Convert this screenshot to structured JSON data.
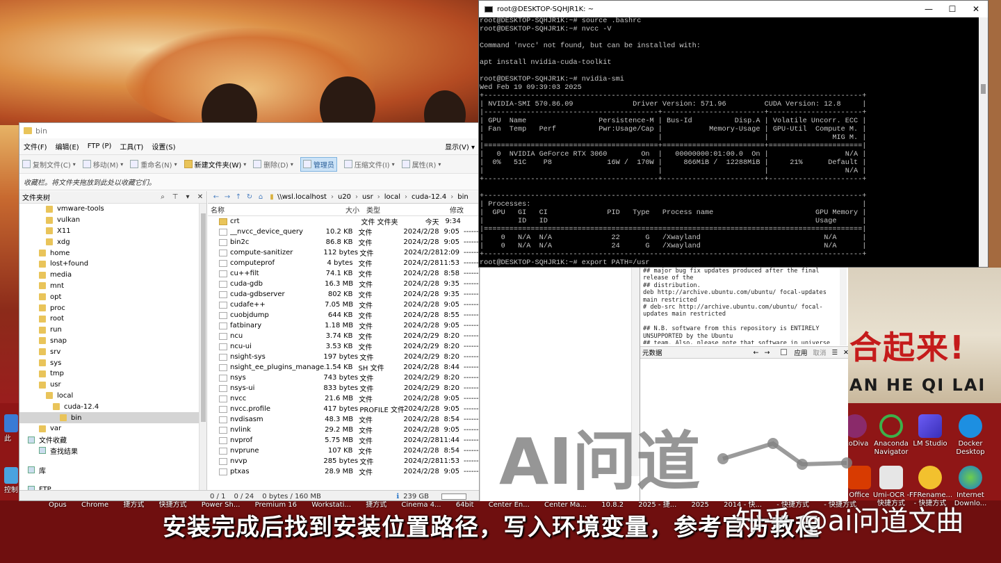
{
  "explorer": {
    "title": "bin",
    "menu": [
      "文件(F)",
      "编辑(E)",
      "FTP (P)",
      "工具(T)",
      "设置(S)"
    ],
    "menu_right": "显示(V) ▾",
    "toolbar": [
      "复制文件(C)",
      "移动(M)",
      "重命名(N)",
      "新建文件夹(W)",
      "删除(D)",
      "管理员",
      "压缩文件(I)",
      "属性(R)"
    ],
    "favorites_hint": "收藏栏。将文件夹拖放到此处以收藏它们。",
    "tree_header": "文件夹树",
    "tree": [
      {
        "label": "vmware-tools",
        "indent": 2
      },
      {
        "label": "vulkan",
        "indent": 2
      },
      {
        "label": "X11",
        "indent": 2
      },
      {
        "label": "xdg",
        "indent": 2
      },
      {
        "label": "home",
        "indent": 1
      },
      {
        "label": "lost+found",
        "indent": 1
      },
      {
        "label": "media",
        "indent": 1
      },
      {
        "label": "mnt",
        "indent": 1
      },
      {
        "label": "opt",
        "indent": 1
      },
      {
        "label": "proc",
        "indent": 1
      },
      {
        "label": "root",
        "indent": 1
      },
      {
        "label": "run",
        "indent": 1
      },
      {
        "label": "snap",
        "indent": 1
      },
      {
        "label": "srv",
        "indent": 1
      },
      {
        "label": "sys",
        "indent": 1
      },
      {
        "label": "tmp",
        "indent": 1
      },
      {
        "label": "usr",
        "indent": 1
      },
      {
        "label": "local",
        "indent": 2
      },
      {
        "label": "cuda-12.4",
        "indent": 3
      },
      {
        "label": "bin",
        "indent": 4,
        "selected": true
      },
      {
        "label": "var",
        "indent": 1
      }
    ],
    "tree_extras": [
      "文件收藏",
      "查找结果",
      "库",
      "FTP"
    ],
    "address": [
      "\\\\wsl.localhost",
      "u20",
      "usr",
      "local",
      "cuda-12.4",
      "bin"
    ],
    "columns": {
      "name": "名称",
      "size": "大小",
      "type": "类型",
      "modified": "修改"
    },
    "files": [
      {
        "name": "crt",
        "size": "",
        "type": "文件 文件夹",
        "date": "今天",
        "time": "9:34",
        "perm": "",
        "folder": true
      },
      {
        "name": "__nvcc_device_query",
        "size": "10.2 KB",
        "type": "文件",
        "date": "2024/2/28",
        "time": "9:05",
        "perm": "-------"
      },
      {
        "name": "bin2c",
        "size": "86.8 KB",
        "type": "文件",
        "date": "2024/2/28",
        "time": "9:05",
        "perm": "-------"
      },
      {
        "name": "compute-sanitizer",
        "size": "112 bytes",
        "type": "文件",
        "date": "2024/2/28",
        "time": "12:09",
        "perm": "-------"
      },
      {
        "name": "computeprof",
        "size": "4 bytes",
        "type": "文件",
        "date": "2024/2/28",
        "time": "11:53",
        "perm": "-------"
      },
      {
        "name": "cu++filt",
        "size": "74.1 KB",
        "type": "文件",
        "date": "2024/2/28",
        "time": "8:58",
        "perm": "-------"
      },
      {
        "name": "cuda-gdb",
        "size": "16.3 MB",
        "type": "文件",
        "date": "2024/2/28",
        "time": "9:35",
        "perm": "-------"
      },
      {
        "name": "cuda-gdbserver",
        "size": "802 KB",
        "type": "文件",
        "date": "2024/2/28",
        "time": "9:35",
        "perm": "-------"
      },
      {
        "name": "cudafe++",
        "size": "7.05 MB",
        "type": "文件",
        "date": "2024/2/28",
        "time": "9:05",
        "perm": "-------"
      },
      {
        "name": "cuobjdump",
        "size": "644 KB",
        "type": "文件",
        "date": "2024/2/28",
        "time": "8:55",
        "perm": "-------"
      },
      {
        "name": "fatbinary",
        "size": "1.18 MB",
        "type": "文件",
        "date": "2024/2/28",
        "time": "9:05",
        "perm": "-------"
      },
      {
        "name": "ncu",
        "size": "3.74 KB",
        "type": "文件",
        "date": "2024/2/29",
        "time": "8:20",
        "perm": "-------"
      },
      {
        "name": "ncu-ui",
        "size": "3.53 KB",
        "type": "文件",
        "date": "2024/2/29",
        "time": "8:20",
        "perm": "-------"
      },
      {
        "name": "nsight-sys",
        "size": "197 bytes",
        "type": "文件",
        "date": "2024/2/29",
        "time": "8:20",
        "perm": "-------"
      },
      {
        "name": "nsight_ee_plugins_manage.sh",
        "size": "1.54 KB",
        "type": "SH 文件",
        "date": "2024/2/28",
        "time": "8:44",
        "perm": "-------"
      },
      {
        "name": "nsys",
        "size": "743 bytes",
        "type": "文件",
        "date": "2024/2/29",
        "time": "8:20",
        "perm": "-------"
      },
      {
        "name": "nsys-ui",
        "size": "833 bytes",
        "type": "文件",
        "date": "2024/2/29",
        "time": "8:20",
        "perm": "-------"
      },
      {
        "name": "nvcc",
        "size": "21.6 MB",
        "type": "文件",
        "date": "2024/2/28",
        "time": "9:05",
        "perm": "-------"
      },
      {
        "name": "nvcc.profile",
        "size": "417 bytes",
        "type": "PROFILE 文件",
        "date": "2024/2/28",
        "time": "9:05",
        "perm": "-------"
      },
      {
        "name": "nvdisasm",
        "size": "48.3 MB",
        "type": "文件",
        "date": "2024/2/28",
        "time": "8:54",
        "perm": "-------"
      },
      {
        "name": "nvlink",
        "size": "29.2 MB",
        "type": "文件",
        "date": "2024/2/28",
        "time": "9:05",
        "perm": "-------"
      },
      {
        "name": "nvprof",
        "size": "5.75 MB",
        "type": "文件",
        "date": "2024/2/28",
        "time": "11:44",
        "perm": "-------"
      },
      {
        "name": "nvprune",
        "size": "107 KB",
        "type": "文件",
        "date": "2024/2/28",
        "time": "8:54",
        "perm": "-------"
      },
      {
        "name": "nvvp",
        "size": "285 bytes",
        "type": "文件",
        "date": "2024/2/28",
        "time": "11:53",
        "perm": "-------"
      },
      {
        "name": "ptxas",
        "size": "28.9 MB",
        "type": "文件",
        "date": "2024/2/28",
        "time": "9:05",
        "perm": "-------"
      }
    ],
    "tab_label": "bin",
    "status": {
      "sel": "0 / 1",
      "files": "0 / 24",
      "bytes": "0 bytes / 160 MB",
      "disk": "239 GB"
    }
  },
  "terminal": {
    "title": "root@DESKTOP-SQHJR1K: ~",
    "lines": [
      "root@DESKTOP-SQHJR1K:~# source .bashrc",
      "root@DESKTOP-SQHJR1K:~# nvcc -V",
      "",
      "Command 'nvcc' not found, but can be installed with:",
      "",
      "apt install nvidia-cuda-toolkit",
      "",
      "root@DESKTOP-SQHJR1K:~# nvidia-smi",
      "Wed Feb 19 09:39:03 2025",
      "+-----------------------------------------------------------------------------------------+",
      "| NVIDIA-SMI 570.86.09              Driver Version: 571.96         CUDA Version: 12.8     |",
      "|-----------------------------------------+------------------------+----------------------+",
      "| GPU  Name                 Persistence-M | Bus-Id          Disp.A | Volatile Uncorr. ECC |",
      "| Fan  Temp   Perf          Pwr:Usage/Cap |           Memory-Usage | GPU-Util  Compute M. |",
      "|                                         |                        |               MIG M. |",
      "|=========================================+========================+======================|",
      "|   0  NVIDIA GeForce RTX 3060        On  |   00000000:01:00.0  On |                  N/A |",
      "|  0%   51C    P8             16W /  170W |     866MiB /  12288MiB |     21%      Default |",
      "|                                         |                        |                  N/A |",
      "+-----------------------------------------+------------------------+----------------------+",
      "",
      "+-----------------------------------------------------------------------------------------+",
      "| Processes:                                                                              |",
      "|  GPU   GI   CI              PID   Type   Process name                        GPU Memory |",
      "|        ID   ID                                                               Usage      |",
      "|=========================================================================================|",
      "|    0   N/A  N/A              22      G   /Xwayland                             N/A      |",
      "|    0   N/A  N/A              24      G   /Xwayland                             N/A      |",
      "+-----------------------------------------------------------------------------------------+",
      "root@DESKTOP-SQHJR1K:~# export PATH=/usr"
    ],
    "buttons": [
      "—",
      "☐",
      "✕"
    ]
  },
  "midpanel": {
    "text": "## major bug fix updates produced after the final\nrelease of the\n## distribution.\ndeb http://archive.ubuntu.com/ubuntu/ focal-updates\nmain restricted\n# deb-src http://archive.ubuntu.com/ubuntu/ focal-\nupdates main restricted\n\n## N.B. software from this repository is ENTIRELY\nUNSUPPORTED by the Ubuntu\n## team. Also, please note that software in universe",
    "header": "元数据",
    "apply": "应用",
    "cancel": "取消"
  },
  "desktop": {
    "icons": [
      {
        "label": "otoDiva"
      },
      {
        "label": "Anaconda Navigator"
      },
      {
        "label": "LM Studio"
      },
      {
        "label": "Docker Desktop"
      },
      {
        "label": "Office"
      },
      {
        "label": "Umi-OCR - 快捷方式"
      },
      {
        "label": "FFRename... - 快捷方式"
      },
      {
        "label": "Internet Downlo..."
      }
    ],
    "left_labels": [
      "此",
      "控制"
    ],
    "taskbar_labels": [
      "Opus",
      "Chrome",
      "捷方式",
      "快捷方式",
      "Power Sh...",
      "Premium 16",
      "Workstati...",
      "捷方式",
      "Cinema 4...",
      "64bit",
      "Center En...",
      "Center Ma...",
      "10.8.2",
      "2025 - 捷...",
      "2025",
      "2014 - 快...",
      "- 快捷方式",
      "- 快捷方式"
    ],
    "banner": "合起来!",
    "banner_sub": "AN HE QI LAI"
  },
  "overlay": {
    "subtitle": "安装完成后找到安装位置路径，写入环境变量，参考官方教程",
    "watermark": "AI问道",
    "zhihu": "知乎 @ai问道文曲"
  }
}
